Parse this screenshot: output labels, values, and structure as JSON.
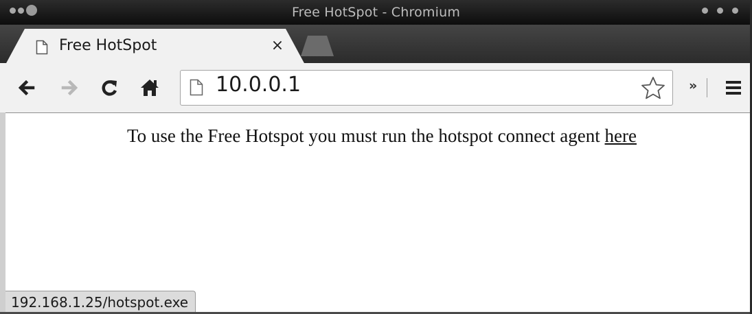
{
  "window": {
    "title": "Free HotSpot - Chromium"
  },
  "tab": {
    "title": "Free HotSpot",
    "close_label": "×",
    "favicon": "page-icon"
  },
  "toolbar": {
    "back_icon": "back-arrow-icon",
    "forward_icon": "forward-arrow-icon",
    "reload_icon": "reload-icon",
    "home_icon": "home-icon",
    "url": "10.0.0.1",
    "bookmark_icon": "star-icon",
    "overflow_label": "»",
    "menu_icon": "hamburger-menu-icon"
  },
  "page": {
    "message": "To use the Free Hotspot you must run the hotspot connect agent",
    "link_text": "here"
  },
  "status": {
    "url": "192.168.1.25/hotspot.exe"
  }
}
